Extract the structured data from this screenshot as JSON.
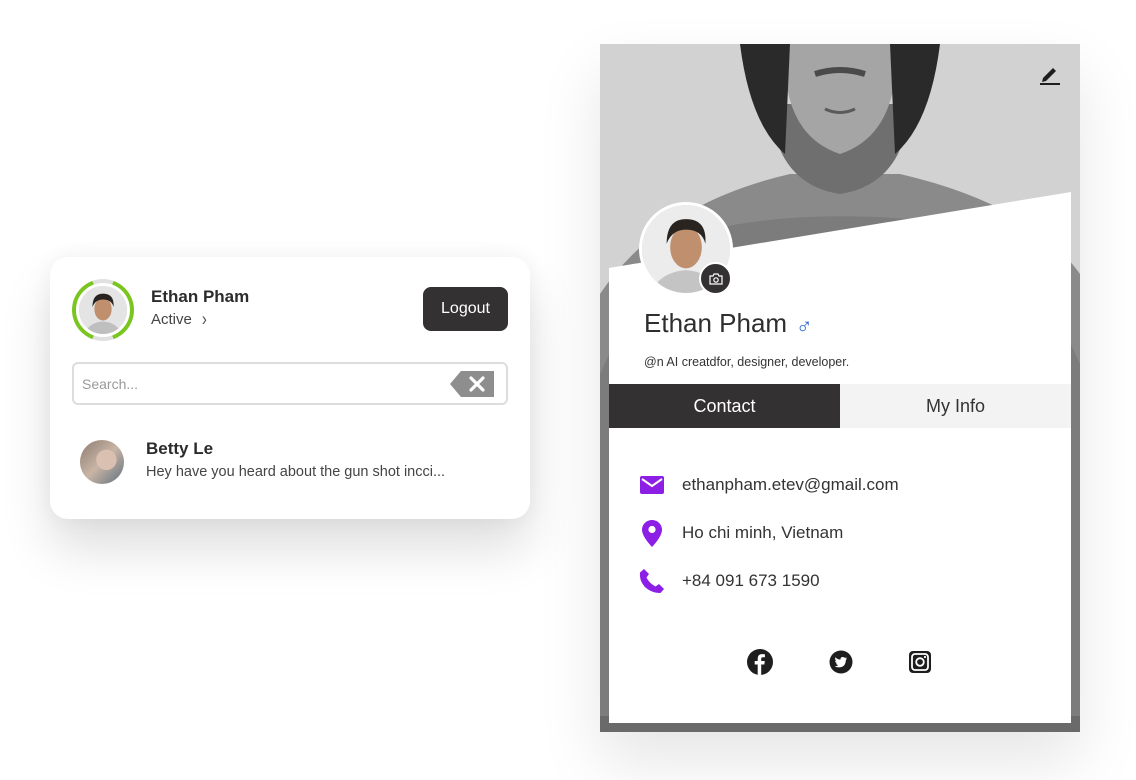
{
  "widget": {
    "user": {
      "name": "Ethan Pham",
      "status": "Active",
      "status_chevron": "›"
    },
    "logout_label": "Logout",
    "search": {
      "placeholder": "Search...",
      "value": ""
    },
    "conversations": [
      {
        "name": "Betty Le",
        "preview": "Hey have you heard about the gun shot incci..."
      }
    ],
    "colors": {
      "active_ring": "#7ac520",
      "button": "#333132"
    }
  },
  "profile": {
    "name": "Ethan Pham",
    "gender_symbol": "♂",
    "bio": "@n AI creatdfor, designer, developer.",
    "tabs": [
      {
        "label": "Contact",
        "active": true
      },
      {
        "label": "My Info",
        "active": false
      }
    ],
    "contacts": [
      {
        "icon": "mail-icon",
        "text": "ethanpham.etev@gmail.com"
      },
      {
        "icon": "location-pin-icon",
        "text": "Ho chi minh, Vietnam"
      },
      {
        "icon": "phone-icon",
        "text": "+84 091 673 1590"
      }
    ],
    "social": [
      "facebook-icon",
      "twitter-icon",
      "instagram-icon"
    ],
    "colors": {
      "accent": "#8c1ee6",
      "gender": "#2a63d6",
      "tab_active": "#333132"
    }
  }
}
